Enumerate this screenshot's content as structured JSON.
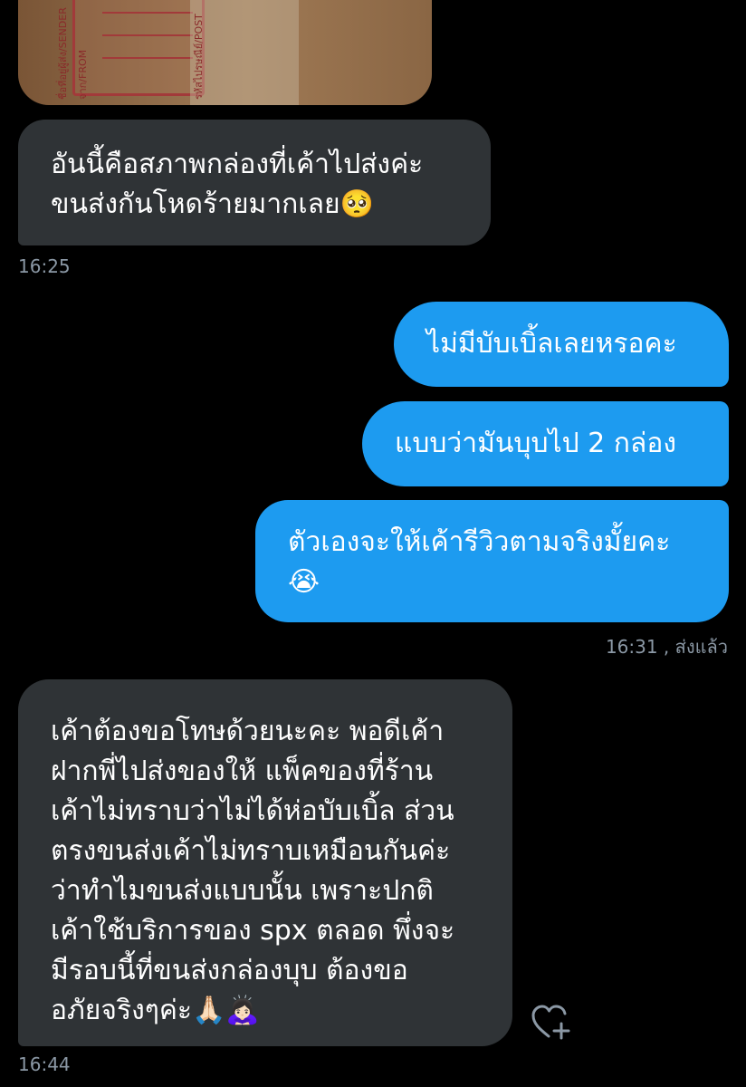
{
  "photo": {
    "label_text_1": "ชื่อที่อยู่ผู้ส่ง/SENDER",
    "label_text_2": "จาก/FROM",
    "label_text_3": "รหัสไปรษณีย์/POST"
  },
  "messages": [
    {
      "direction": "incoming",
      "text": "อันนี้คือสภาพกล่องที่เค้าไปส่งค่ะ\nขนส่งกันโหดร้ายมากเลย🥺",
      "time": "16:25"
    },
    {
      "direction": "outgoing",
      "text": "ไม่มีบับเบิ้ลเลยหรอคะ"
    },
    {
      "direction": "outgoing",
      "text": "แบบว่ามันบุบไป 2 กล่อง"
    },
    {
      "direction": "outgoing",
      "text": "ตัวเองจะให้เค้ารีวิวตามจริงมั้ยคะ\n😭",
      "time": "16:31 , ส่งแล้ว"
    },
    {
      "direction": "incoming",
      "text": "เค้าต้องขอโทษด้วยนะคะ พอดีเค้า\nฝากพี่ไปส่งของให้  แพ็คของที่ร้าน\nเค้าไม่ทราบว่าไม่ได้ห่อบับเบิ้ล ส่วน\nตรงขนส่งเค้าไม่ทราบเหมือนกันค่ะ\nว่าทำไมขนส่งแบบนั้น เพราะปกติ\nเค้าใช้บริการของ spx ตลอด พึ่งจะ\nมีรอบนี้ที่ขนส่งกล่องบุบ ต้องขอ\nอภัยจริงๆค่ะ🙏🏻🙇🏻‍♀️",
      "time": "16:44"
    }
  ],
  "react_icon": "heart-plus-icon",
  "colors": {
    "background": "#000000",
    "incoming_bubble": "#2f3336",
    "outgoing_bubble": "#1d9bf0",
    "timestamp": "#8b98a5"
  }
}
